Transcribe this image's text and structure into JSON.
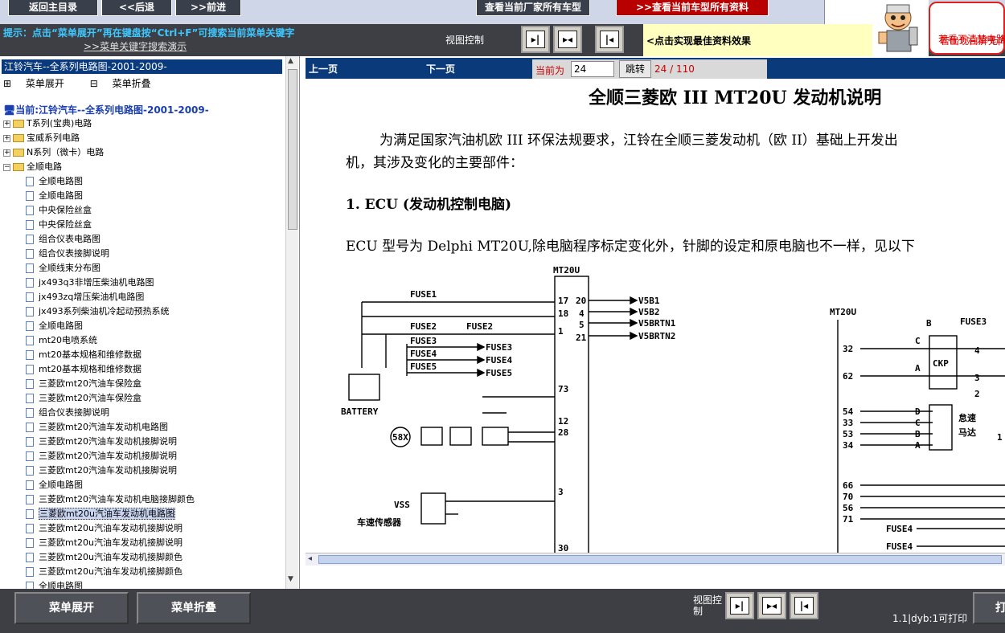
{
  "top": {
    "btn_home": "返回主目录",
    "btn_back": "<<后退",
    "btn_forward": ">>前进",
    "btn_all_models": "查看当前厂家所有车型",
    "btn_all_docs": "查看当前车型所有资料",
    "btn_all_docs_prefix": ">>"
  },
  "hint": {
    "line1": "提示：点击“菜单展开”再在键盘按“Ctrl+F”可搜索当前菜单关键字",
    "line2": ">>菜单关键字搜索演示",
    "view_control": "视图控制",
    "best_effect": "<点击实现最佳资料效果",
    "tip1": "若看不清楚电路",
    "tip2": "若出现白屏无内"
  },
  "left": {
    "header": "江铃汽车--全系列电路图-2001-2009-",
    "expand": "菜单展开",
    "collapse": "菜单折叠",
    "current": "当前:江铃汽车--全系列电路图-2001-2009-",
    "folders": [
      "T系列(宝典)电路",
      "宝威系列电路",
      "N系列（微卡）电路",
      "全顺电路"
    ],
    "items": [
      "全顺电路图",
      "全顺电路图",
      "中央保险丝盒",
      "中央保险丝盒",
      "组合仪表电路图",
      "组合仪表接脚说明",
      "全顺线束分布图",
      "jx493q3非增压柴油机电路图",
      "jx493zq增压柴油机电路图",
      "jx493系列柴油机冷起动预热系统",
      "全顺电路图",
      "mt20电喷系统",
      "mt20基本规格和维修数据",
      "mt20基本规格和维修数据",
      "三菱欧mt20汽油车保险盒",
      "三菱欧mt20汽油车保险盒",
      "组合仪表接脚说明",
      "三菱欧mt20汽油车发动机电路图",
      "三菱欧mt20汽油车发动机接脚说明",
      "三菱欧mt20汽油车发动机接脚说明",
      "三菱欧mt20汽油车发动机接脚说明",
      "全顺电路图",
      "三菱欧mt20汽油车发动机电脑接脚颜色",
      "三菱欧mt20u汽油车发动机电路图",
      "三菱欧mt20u汽油车发动机接脚说明",
      "三菱欧mt20u汽油车发动机接脚说明",
      "三菱欧mt20u汽油车发动机接脚颜色",
      "三菱欧mt20u汽油车发动机接脚颜色",
      "全顺电路图"
    ],
    "selected_index": 23
  },
  "nav": {
    "prev": "上一页",
    "next": "下一页",
    "current_label": "当前为",
    "page_value": "24",
    "jump": "跳转",
    "page_info": "24 / 110"
  },
  "doc": {
    "title": "全顺三菱欧 III  MT20U 发动机说明",
    "para1a": "为满足国家汽油机欧 III 环保法规要求，江铃在全顺三菱发动机（欧 II）基础上开发出",
    "para1b": "机，其涉及变化的主要部件：",
    "sec1": "1.    ECU (发动机控制电脑)",
    "para2": "ECU 型号为 Delphi MT20U,除电脑程序标定变化外，针脚的设定和原电脑也不一样，见以下",
    "diagram": {
      "ecu_label": "MT20U",
      "ecu_label2": "MT20U",
      "fuse1": "FUSE1",
      "fuse2a": "FUSE2",
      "fuse2b": "FUSE2",
      "fuse3": "FUSE3",
      "fuse4": "FUSE4",
      "fuse5": "FUSE5",
      "fuse3_out": "FUSE3",
      "fuse4_out": "FUSE4",
      "fuse5_out": "FUSE5",
      "fuse3_r": "FUSE3",
      "fuse4_r1": "FUSE4",
      "fuse4_r2": "FUSE4",
      "battery": "BATTERY",
      "pins_left": [
        "17",
        "18",
        "1",
        "73",
        "12",
        "28",
        "3",
        "30"
      ],
      "pins_right": [
        "20",
        "4",
        "5",
        "21"
      ],
      "outputs": [
        "V5B1",
        "V5B2",
        "V5BRTN1",
        "V5BRTN2"
      ],
      "sensor_58x": "58X",
      "vss": "VSS",
      "vss_cn": "车速传感器",
      "r_pins": [
        "32",
        "62",
        "54",
        "33",
        "53",
        "34",
        "66",
        "70",
        "56",
        "71"
      ],
      "ckp": "CKP",
      "motor1": "怠速",
      "motor2": "马达",
      "r_nums": [
        "4",
        "3",
        "2",
        "1"
      ],
      "r_letters": [
        "B",
        "C",
        "A",
        "D",
        "C",
        "B",
        "A"
      ]
    }
  },
  "bottom": {
    "expand": "菜单展开",
    "collapse": "菜单折叠",
    "view_control": "视图控制",
    "print_info": "1.1|dyb:1可打印",
    "right_btn": "打"
  }
}
